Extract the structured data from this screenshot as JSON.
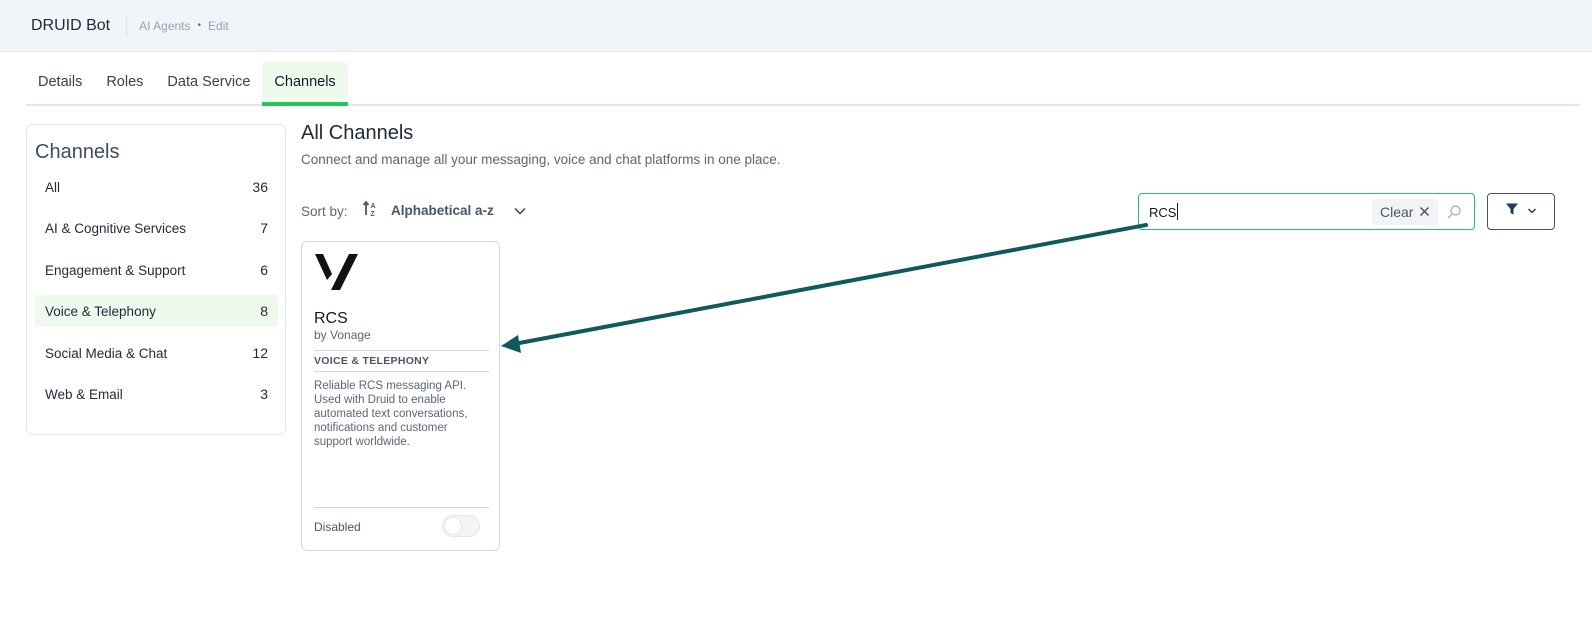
{
  "header": {
    "app_title": "DRUID Bot",
    "breadcrumb": [
      "AI Agents",
      "Edit"
    ],
    "breadcrumb_separator": "•"
  },
  "tabs": [
    {
      "label": "Details",
      "active": false
    },
    {
      "label": "Roles",
      "active": false
    },
    {
      "label": "Data Service",
      "active": false
    },
    {
      "label": "Channels",
      "active": true
    }
  ],
  "sidebar": {
    "title": "Channels",
    "items": [
      {
        "label": "All",
        "count": "36",
        "active": false
      },
      {
        "label": "AI & Cognitive Services",
        "count": "7",
        "active": false
      },
      {
        "label": "Engagement & Support",
        "count": "6",
        "active": false
      },
      {
        "label": "Voice & Telephony",
        "count": "8",
        "active": true
      },
      {
        "label": "Social Media & Chat",
        "count": "12",
        "active": false
      },
      {
        "label": "Web & Email",
        "count": "3",
        "active": false
      }
    ]
  },
  "main": {
    "title": "All Channels",
    "subtitle": "Connect and manage all your messaging, voice and chat platforms in one place.",
    "sort": {
      "label": "Sort by:",
      "value": "Alphabetical a-z",
      "icon": "sort-ascending-icon"
    },
    "search": {
      "value": "RCS",
      "clear_label": "Clear",
      "icon": "search-icon"
    },
    "filter": {
      "icon": "filter-icon"
    }
  },
  "cards": [
    {
      "name": "RCS",
      "vendor": "by Vonage",
      "category": "VOICE & TELEPHONY",
      "description": "Reliable RCS messaging API. Used with Druid to enable automated text conversations, notifications and customer support worldwide.",
      "status": "Disabled",
      "enabled": false
    }
  ],
  "colors": {
    "accent": "#22c55e",
    "active_bg": "#eef8ec",
    "arrow": "#0f5a5c",
    "topbar_bg": "#f1f4f8"
  }
}
